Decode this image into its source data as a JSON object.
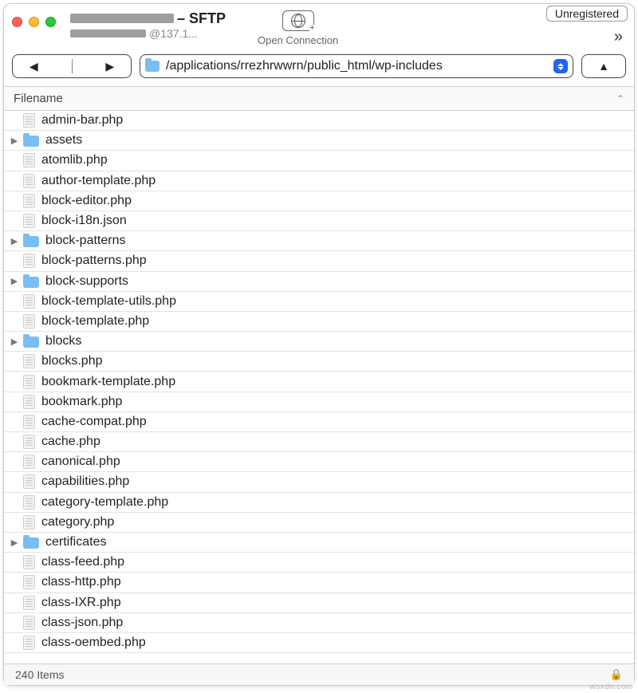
{
  "header": {
    "suffix": "– SFTP",
    "subhost": "@137.1...",
    "open_connection_label": "Open Connection",
    "unregistered_label": "Unregistered",
    "overflow_glyph": "»"
  },
  "nav": {
    "back_glyph": "◀",
    "forward_glyph": "▶",
    "up_glyph": "▲"
  },
  "path": "/applications/rrezhrwwrn/public_html/wp-includes",
  "column_header": "Filename",
  "sort_glyph": "⌃",
  "files": [
    {
      "name": "admin-bar.php",
      "type": "file"
    },
    {
      "name": "assets",
      "type": "folder"
    },
    {
      "name": "atomlib.php",
      "type": "file"
    },
    {
      "name": "author-template.php",
      "type": "file"
    },
    {
      "name": "block-editor.php",
      "type": "file"
    },
    {
      "name": "block-i18n.json",
      "type": "file"
    },
    {
      "name": "block-patterns",
      "type": "folder"
    },
    {
      "name": "block-patterns.php",
      "type": "file"
    },
    {
      "name": "block-supports",
      "type": "folder"
    },
    {
      "name": "block-template-utils.php",
      "type": "file"
    },
    {
      "name": "block-template.php",
      "type": "file"
    },
    {
      "name": "blocks",
      "type": "folder"
    },
    {
      "name": "blocks.php",
      "type": "file"
    },
    {
      "name": "bookmark-template.php",
      "type": "file"
    },
    {
      "name": "bookmark.php",
      "type": "file"
    },
    {
      "name": "cache-compat.php",
      "type": "file"
    },
    {
      "name": "cache.php",
      "type": "file"
    },
    {
      "name": "canonical.php",
      "type": "file"
    },
    {
      "name": "capabilities.php",
      "type": "file"
    },
    {
      "name": "category-template.php",
      "type": "file"
    },
    {
      "name": "category.php",
      "type": "file"
    },
    {
      "name": "certificates",
      "type": "folder"
    },
    {
      "name": "class-feed.php",
      "type": "file"
    },
    {
      "name": "class-http.php",
      "type": "file"
    },
    {
      "name": "class-IXR.php",
      "type": "file"
    },
    {
      "name": "class-json.php",
      "type": "file"
    },
    {
      "name": "class-oembed.php",
      "type": "file"
    }
  ],
  "status_text": "240 Items",
  "lock_glyph": "🔒",
  "watermark": "wsxdn.com"
}
